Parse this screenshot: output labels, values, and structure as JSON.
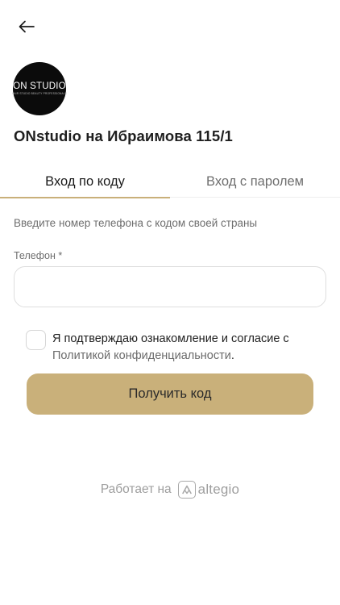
{
  "header": {
    "back_icon": "arrow-left-icon"
  },
  "company": {
    "logo_text": "ON STUDIO",
    "logo_subtext": "HAIR STUDIO BEAUTY PROFESSIONALS",
    "name": "ONstudio на Ибраимова 115/1"
  },
  "tabs": [
    {
      "label": "Вход по коду",
      "active": true
    },
    {
      "label": "Вход с паролем",
      "active": false
    }
  ],
  "form": {
    "hint": "Введите номер телефона с кодом своей страны",
    "phone_label": "Телефон *",
    "phone_value": "",
    "phone_placeholder": "",
    "consent_text": "Я подтверждаю ознакомление и согласие с ",
    "consent_link": "Политикой конфиденциальности",
    "consent_suffix": ".",
    "consent_checked": false,
    "submit_label": "Получить код"
  },
  "footer": {
    "powered_by": "Работает на",
    "brand_name": "altegio",
    "brand_icon": "altegio-logo-icon"
  },
  "colors": {
    "accent": "#c9b07a",
    "muted_text": "#6e6e6e",
    "border": "#dedede"
  }
}
